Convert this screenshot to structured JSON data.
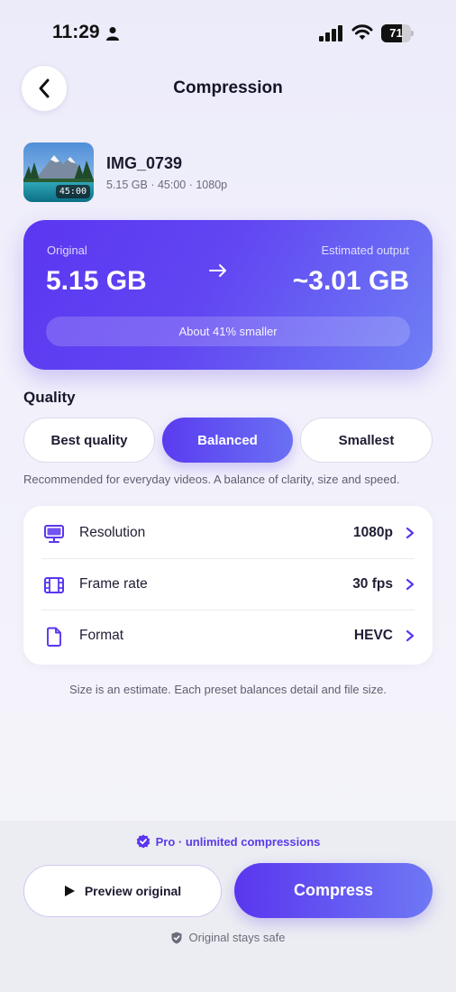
{
  "status_bar": {
    "time": "11:29",
    "battery_level": "71",
    "icons": [
      "person-icon",
      "signal-icon",
      "wifi-icon",
      "battery-icon"
    ]
  },
  "nav": {
    "title": "Compression",
    "back_icon": "chevron-left-icon"
  },
  "file": {
    "name": "IMG_0739",
    "meta": "5.15 GB · 45:00 · 1080p",
    "duration": "45:00"
  },
  "size_card": {
    "original_label": "Original",
    "original_value": "5.15 GB",
    "estimated_label": "Estimated output",
    "estimated_value": "~3.01 GB",
    "savings": "About 41% smaller",
    "arrow_icon": "arrow-right-icon"
  },
  "quality": {
    "title": "Quality",
    "options": [
      {
        "label": "Best quality",
        "selected": false
      },
      {
        "label": "Balanced",
        "selected": true
      },
      {
        "label": "Smallest",
        "selected": false
      }
    ],
    "description": "Recommended for everyday videos. A balance of clarity, size and speed."
  },
  "settings": [
    {
      "label": "Resolution",
      "value": "1080p",
      "icon": "monitor-icon"
    },
    {
      "label": "Frame rate",
      "value": "30 fps",
      "icon": "film-icon"
    },
    {
      "label": "Format",
      "value": "HEVC",
      "icon": "file-icon"
    }
  ],
  "footnote": "Size is an estimate. Each preset balances detail and file size.",
  "bottom": {
    "pro_text": "Pro · unlimited compressions",
    "preview_label": "Preview original",
    "compress_label": "Compress",
    "safe_text": "Original stays safe"
  },
  "colors": {
    "accent": "#5a36ef",
    "accent_light": "#6e78f4",
    "background": "#efeefa"
  }
}
